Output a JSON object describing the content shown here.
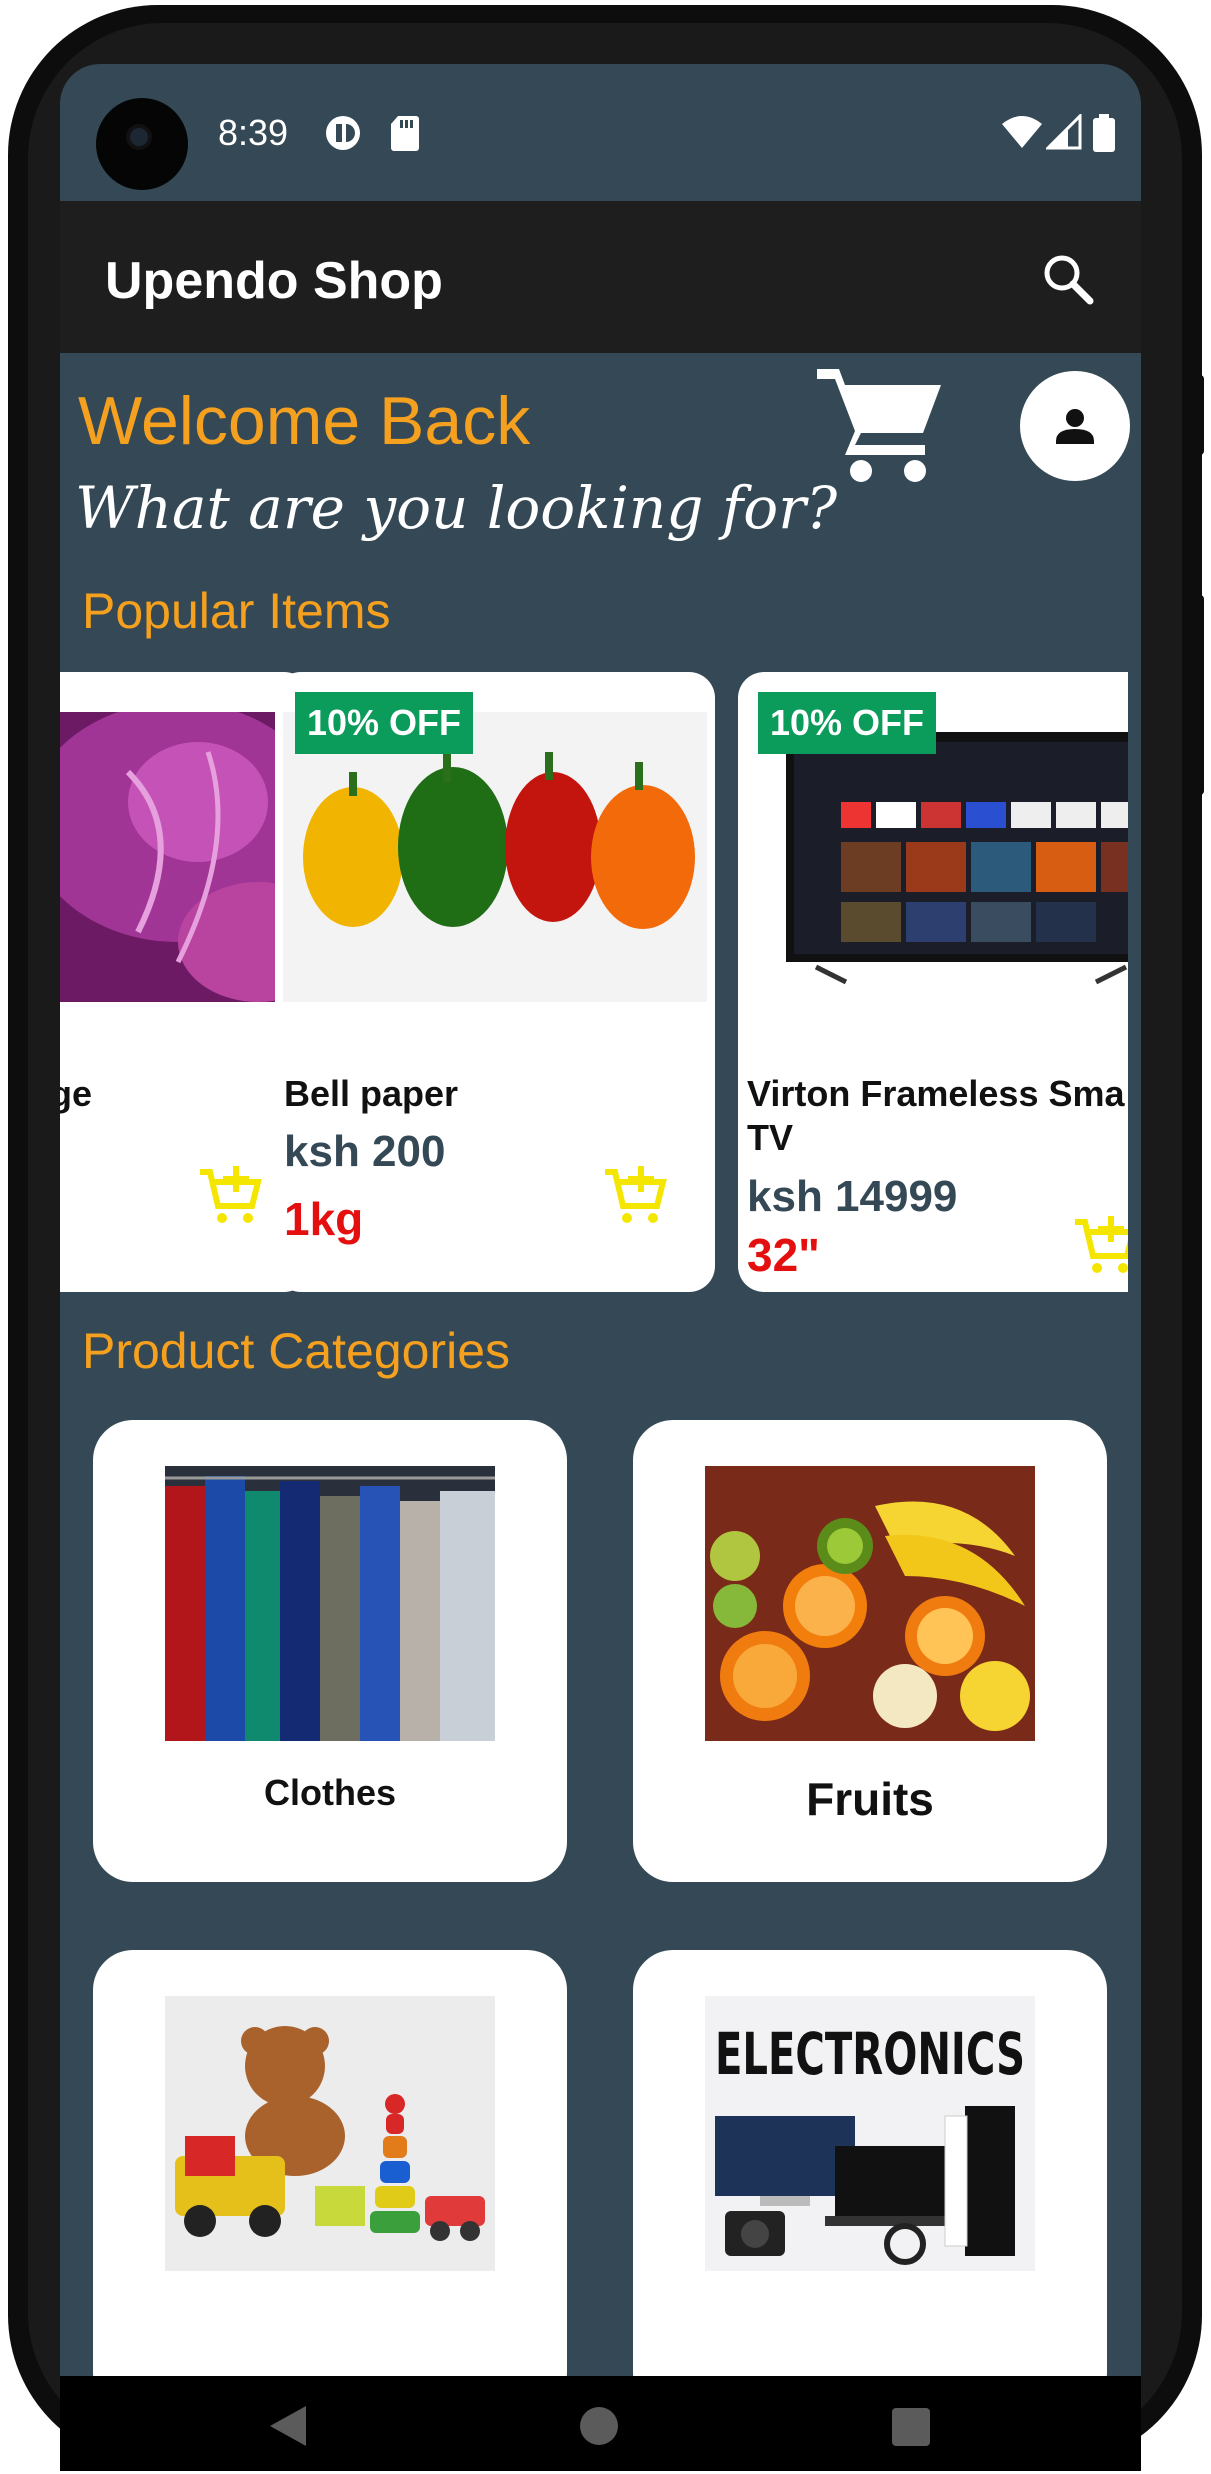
{
  "status_bar": {
    "time": "8:39"
  },
  "toolbar": {
    "title": "Upendo Shop"
  },
  "header": {
    "welcome": "Welcome Back",
    "prompt": "What are you looking for?"
  },
  "sections": {
    "popular": "Popular Items",
    "categories": "Product Categories"
  },
  "popular_items": [
    {
      "name": "ge",
      "price": "",
      "qty": "",
      "badge": ""
    },
    {
      "name": "Bell paper",
      "price": "ksh 200",
      "qty": "1kg",
      "badge": "10% OFF"
    },
    {
      "name": "Virton Frameless Sma",
      "name_line2": "TV",
      "price": "ksh 14999",
      "qty": "32\"",
      "badge": "10% OFF"
    }
  ],
  "categories": [
    {
      "label": "Clothes"
    },
    {
      "label": "Fruits"
    },
    {
      "label": ""
    },
    {
      "label": "ELECTRONICS"
    }
  ],
  "colors": {
    "accent": "#f5a01e",
    "background": "#344955",
    "toolbar": "#1e1e1e",
    "badge": "#0b9b5b",
    "qty": "#e41010",
    "cart_icon": "#f4e600"
  }
}
